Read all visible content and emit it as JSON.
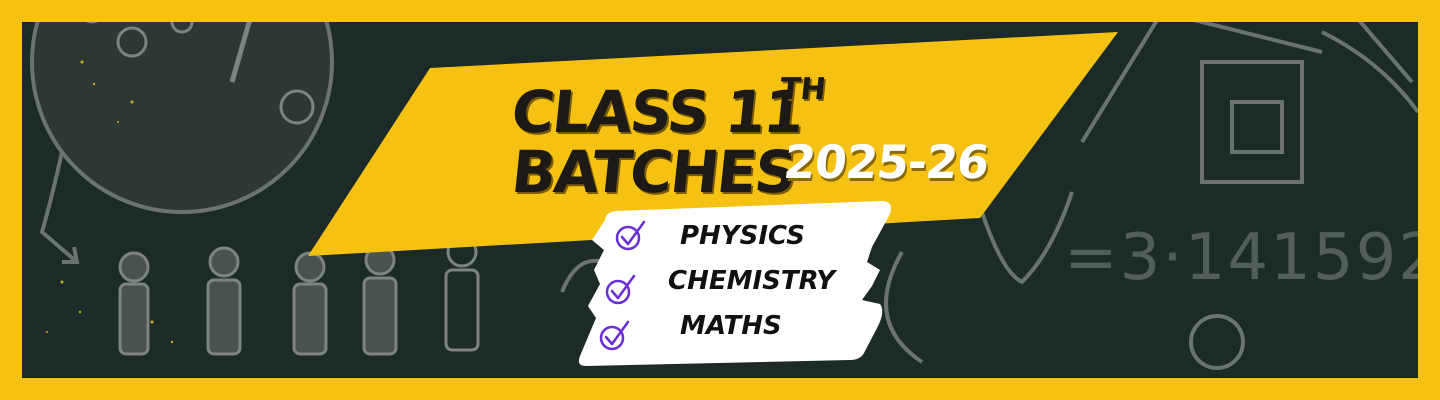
{
  "banner": {
    "title_line1": "CLASS 11",
    "title_superscript": "TH",
    "title_line2": "BATCHES",
    "year": "2025-26",
    "subjects": [
      {
        "label": "PHYSICS"
      },
      {
        "label": "CHEMISTRY"
      },
      {
        "label": "MATHS"
      }
    ],
    "chalk_text": "=3·141592"
  },
  "colors": {
    "frame": "#f5c213",
    "chalkboard": "#1c2a28",
    "ribbon": "#f5c213",
    "title_text": "#1c1917",
    "year_text": "#ffffff",
    "card": "#ffffff",
    "check": "#6a2ed6",
    "chalk": "#5d6663"
  },
  "icons": {
    "check": "checkmark-circle-icon"
  }
}
